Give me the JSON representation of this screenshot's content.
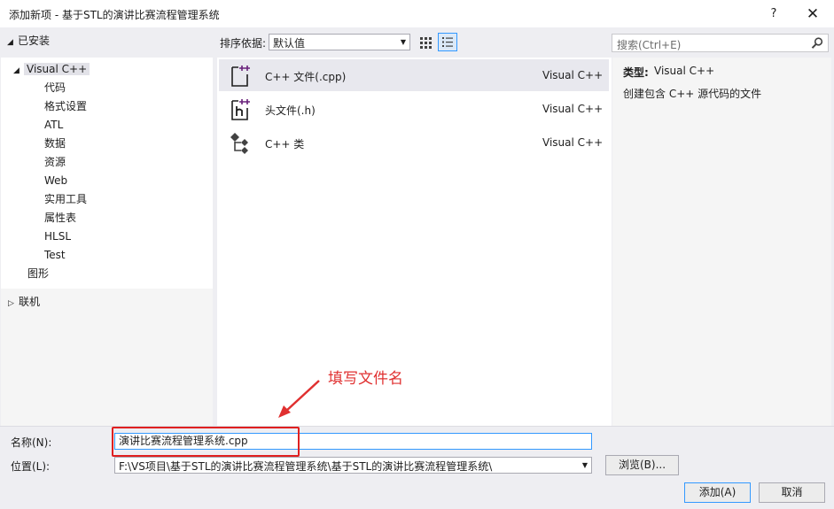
{
  "window": {
    "title": "添加新项 - 基于STL的演讲比赛流程管理系统",
    "help_label": "?",
    "close_label": "✕"
  },
  "left": {
    "installed_label": "已安装",
    "tree": [
      {
        "label": "Visual C++",
        "expanded": true
      },
      {
        "label": "代码"
      },
      {
        "label": "格式设置"
      },
      {
        "label": "ATL"
      },
      {
        "label": "数据"
      },
      {
        "label": "资源"
      },
      {
        "label": "Web"
      },
      {
        "label": "实用工具"
      },
      {
        "label": "属性表"
      },
      {
        "label": "HLSL"
      },
      {
        "label": "Test"
      },
      {
        "label": "图形"
      }
    ],
    "online_label": "联机"
  },
  "toolbar": {
    "sort_label": "排序依据:",
    "sort_value": "默认值"
  },
  "items": [
    {
      "name": "C++ 文件(.cpp)",
      "type": "Visual C++",
      "icon": "cpp-file-icon",
      "selected": true
    },
    {
      "name": "头文件(.h)",
      "type": "Visual C++",
      "icon": "header-file-icon"
    },
    {
      "name": "C++ 类",
      "type": "Visual C++",
      "icon": "cpp-class-icon"
    }
  ],
  "search": {
    "placeholder": "搜索(Ctrl+E)"
  },
  "description": {
    "type_label": "类型:",
    "type_value": "Visual C++",
    "text": "创建包含 C++ 源代码的文件"
  },
  "annotation": {
    "text": "填写文件名",
    "color": "#e03030"
  },
  "form": {
    "name_label": "名称(N):",
    "name_value": "演讲比赛流程管理系统.cpp",
    "location_label": "位置(L):",
    "location_value": "F:\\VS项目\\基于STL的演讲比赛流程管理系统\\基于STL的演讲比赛流程管理系统\\",
    "browse_label": "浏览(B)...",
    "add_label": "添加(A)",
    "cancel_label": "取消"
  },
  "colors": {
    "accent": "#3399ff",
    "icon_purple": "#68217a"
  }
}
